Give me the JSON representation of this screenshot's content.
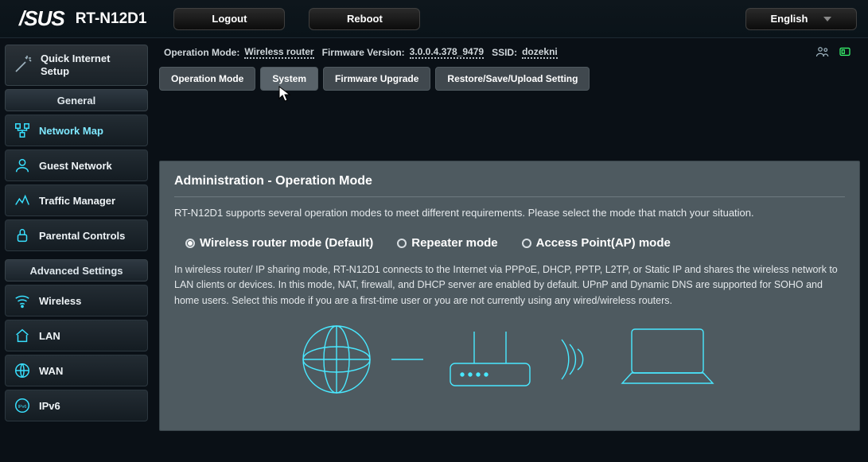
{
  "header": {
    "brand": "/SUS",
    "model": "RT-N12D1",
    "logout": "Logout",
    "reboot": "Reboot",
    "language": "English"
  },
  "sidebar": {
    "quick_setup": "Quick Internet\nSetup",
    "general_title": "General",
    "general": [
      {
        "label": "Network Map"
      },
      {
        "label": "Guest Network"
      },
      {
        "label": "Traffic Manager"
      },
      {
        "label": "Parental Controls"
      }
    ],
    "advanced_title": "Advanced Settings",
    "advanced": [
      {
        "label": "Wireless"
      },
      {
        "label": "LAN"
      },
      {
        "label": "WAN"
      },
      {
        "label": "IPv6"
      }
    ]
  },
  "status": {
    "k_opmode": "Operation Mode:",
    "v_opmode": "Wireless router",
    "k_fw": "Firmware Version:",
    "v_fw": "3.0.0.4.378_9479",
    "k_ssid": "SSID:",
    "v_ssid": "dozekni"
  },
  "tabs": [
    "Operation Mode",
    "System",
    "Firmware Upgrade",
    "Restore/Save/Upload Setting"
  ],
  "panel": {
    "title": "Administration - Operation Mode",
    "desc": "RT-N12D1 supports several operation modes to meet different requirements. Please select the mode that match your situation.",
    "radios": [
      "Wireless router mode (Default)",
      "Repeater mode",
      "Access Point(AP) mode"
    ],
    "mode_text": "In wireless router/ IP sharing mode, RT-N12D1 connects to the Internet via PPPoE, DHCP, PPTP, L2TP, or Static IP and shares the wireless network to LAN clients or devices. In this mode, NAT, firewall, and DHCP server are enabled by default. UPnP and Dynamic DNS are supported for SOHO and home users. Select this mode if you are a first-time user or you are not currently using any wired/wireless routers."
  }
}
